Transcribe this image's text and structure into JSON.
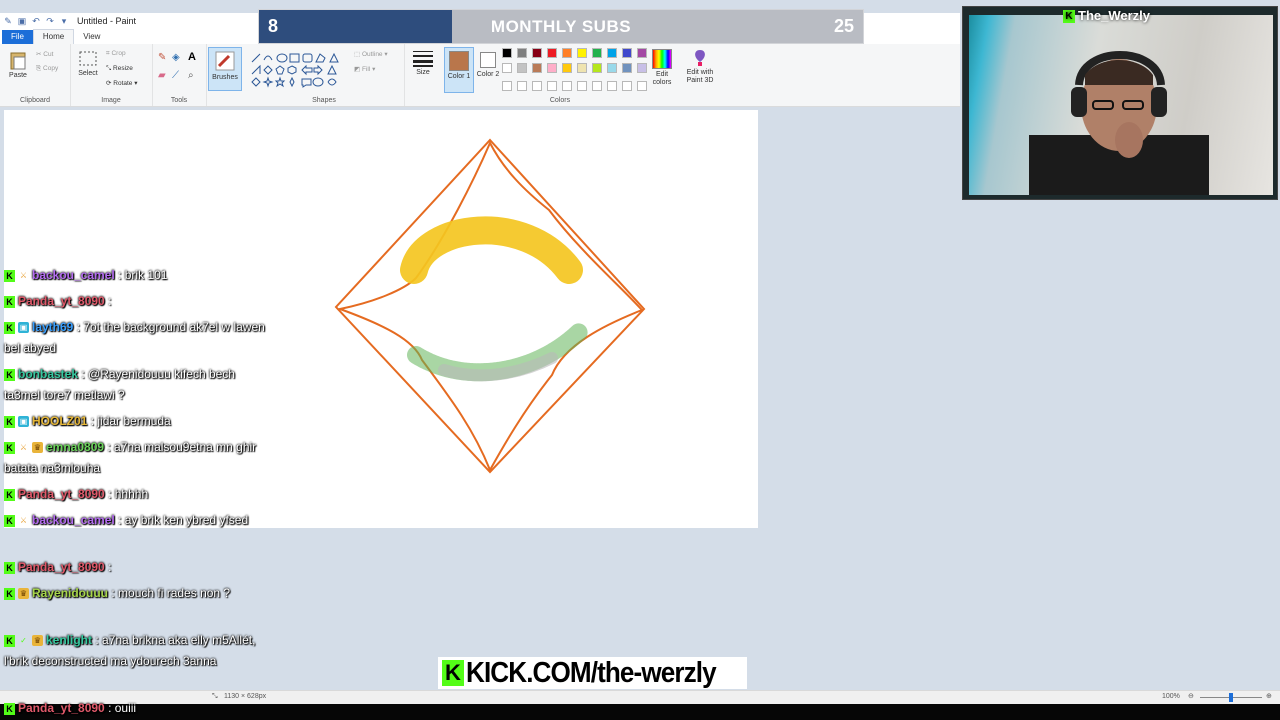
{
  "paint": {
    "title": "Untitled - Paint",
    "tabs": [
      "File",
      "Home",
      "View"
    ],
    "clipboard": {
      "paste": "Paste",
      "cut": "Cut",
      "copy": "Copy",
      "label": "Clipboard"
    },
    "image": {
      "select": "Select",
      "crop": "Crop",
      "resize": "Resize",
      "rotate": "Rotate",
      "label": "Image"
    },
    "tools": {
      "label": "Tools"
    },
    "brushes": "Brushes",
    "shapes": {
      "outline": "Outline",
      "fill": "Fill",
      "label": "Shapes"
    },
    "size": "Size",
    "color1": "Color 1",
    "color2": "Color 2",
    "colors_label": "Colors",
    "edit_colors": "Edit colors",
    "edit_3d": "Edit with Paint 3D",
    "color1_value": "#b9764b",
    "palette": [
      "#000000",
      "#7f7f7f",
      "#880015",
      "#ed1c24",
      "#ff7f27",
      "#fff200",
      "#22b14c",
      "#00a2e8",
      "#3f48cc",
      "#a349a4",
      "#ffffff",
      "#c3c3c3",
      "#b97a57",
      "#ffaec9",
      "#ffc90e",
      "#efe4b0",
      "#b5e61d",
      "#99d9ea",
      "#7092be",
      "#c8bfe7"
    ]
  },
  "status": {
    "size": "1130 × 628px",
    "zoom": "100%"
  },
  "subs": {
    "current": "8",
    "label": "MONTHLY SUBS",
    "goal": "25"
  },
  "webcam": {
    "name": "The_Werzly"
  },
  "chat": [
    {
      "user": "backou_camel",
      "color": "#b46cf0",
      "badges": [
        "mod"
      ],
      "text": ": brik 101"
    },
    {
      "user": "Panda_yt_8090",
      "color": "#e0596a",
      "badges": [],
      "text": ":"
    },
    {
      "user": "layth69",
      "color": "#3aa0ff",
      "badges": [
        "gift"
      ],
      "text": ": 7ot the background ak7el w lawen bel abyed"
    },
    {
      "user": "bonbastek",
      "color": "#36c9a0",
      "badges": [],
      "text": ": @Rayenidouuu kifech bech ta3mel tore7 metlawi ?"
    },
    {
      "user": "HOOLZ01",
      "color": "#e5b637",
      "badges": [
        "gift"
      ],
      "text": ": jidar bermuda"
    },
    {
      "user": "emna0809",
      "color": "#6bd35b",
      "badges": [
        "mod",
        "crown"
      ],
      "text": ": a7na malsou9etna mn ghir batata na3mlouha"
    },
    {
      "user": "Panda_yt_8090",
      "color": "#e0596a",
      "badges": [],
      "text": ": hhhhh"
    },
    {
      "user": "backou_camel",
      "color": "#b46cf0",
      "badges": [
        "mod"
      ],
      "text": ": ay brik ken ybred yfsed"
    },
    {
      "user": "Panda_yt_8090",
      "color": "#e0596a",
      "badges": [],
      "text": ":"
    },
    {
      "user": "Rayenidouuu",
      "color": "#a7d64b",
      "badges": [
        "crown"
      ],
      "text": ": mouch fi rades non ?"
    },
    {
      "user": "kenlight",
      "color": "#36c9a0",
      "badges": [
        "check",
        "crown"
      ],
      "text": ": a7na brikna aka elly m5Allét, l'brik deconstructed ma ydourech 3anna"
    },
    {
      "user": "Panda_yt_8090",
      "color": "#e0596a",
      "badges": [],
      "text": ": ouiii"
    }
  ],
  "kick_banner": "KICK.COM/the-werzly"
}
